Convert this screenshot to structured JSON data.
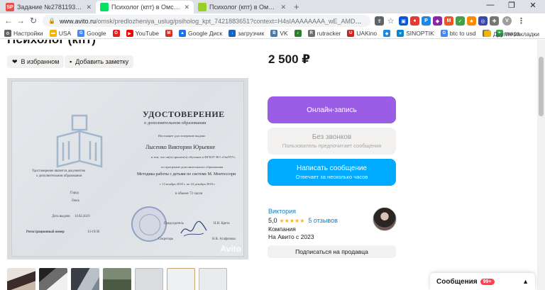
{
  "browser": {
    "tabs": [
      {
        "favicon": "SP",
        "title": "Задание №2781193 - просмотр з..."
      },
      {
        "favicon": "A",
        "title": "Психолог (кпт) в Омске | Услуги ..."
      },
      {
        "favicon": "",
        "title": "Психолог (кпт) в Омске | Услуги..."
      }
    ],
    "new_tab": "+",
    "window_controls": {
      "minimize": "—",
      "maximize": "❐",
      "close": "✕"
    },
    "nav": {
      "back": "←",
      "forward": "→",
      "reload": "↻",
      "home": "⌂"
    },
    "url_host": "www.avito.ru",
    "url_path": "/omsk/predlozheniya_uslug/psiholog_kpt_7421883651?context=H4sIAAAAAAAA_wE_AMD_YToyOntzOjEzOiJsb...",
    "bookmarks": [
      {
        "label": "Настройки",
        "icon": "gear-icon",
        "color": "#5f6368"
      },
      {
        "label": "USA",
        "icon": "folder-icon",
        "color": "#f4b400"
      },
      {
        "label": "Google",
        "icon": "google-icon",
        "color": "#4285f4"
      },
      {
        "label": "",
        "icon": "opera-icon",
        "color": "#e02020"
      },
      {
        "label": "YouTube",
        "icon": "youtube-icon",
        "color": "#ff0000"
      },
      {
        "label": "",
        "icon": "gmail-icon",
        "color": "#d93025"
      },
      {
        "label": "Google Диск",
        "icon": "drive-icon",
        "color": "#1a73e8"
      },
      {
        "label": "загрузчик",
        "icon": "download-icon",
        "color": "#1565c0"
      },
      {
        "label": "VK",
        "icon": "vk-icon",
        "color": "#4a76a8"
      },
      {
        "label": "",
        "icon": "music-icon",
        "color": "#2e7d32"
      },
      {
        "label": "rutracker",
        "icon": "rutracker-icon",
        "color": "#6d6d6d"
      },
      {
        "label": "UAKino",
        "icon": "uakino-icon",
        "color": "#c62828"
      },
      {
        "label": "",
        "icon": "ukraine-icon",
        "color": "#1e88e5"
      },
      {
        "label": "SINOPTIK",
        "icon": "weather-icon",
        "color": "#0288d1"
      },
      {
        "label": "btc to usd",
        "icon": "google-icon",
        "color": "#4285f4"
      },
      {
        "label": "",
        "icon": "doc-icon",
        "color": "#6d6d6d"
      },
      {
        "label": "maps",
        "icon": "maps-icon",
        "color": "#34a853"
      }
    ],
    "other_bookmarks": "Другие закладки"
  },
  "page": {
    "heading": "Психолог (кпт)",
    "favorite_label": "В избранном",
    "note_label": "Добавить заметку",
    "price": "2 500 ₽",
    "watermark": "Avito",
    "certificate": {
      "title": "УДОСТОВЕРЕНИЕ",
      "subtitle": "о дополнительном образовании",
      "line1": "Настоящее удостоверение выдано",
      "name": "Лысенко Виктории Юрьевне",
      "line2": "в том, что он(а) прошел(а) обучение в ФГБОУ ВО «ОмГПУ»",
      "line3": "по программе дополнительного образования",
      "program": "Методика работы с детьми по системе М. Монтессори",
      "dates": "с 13 ноября 2018 г. по 24 декабря 2018 г.",
      "hours": "в объеме 72 часов",
      "left1": "Удостоверение является документом",
      "left2": "о дополнительном образовании",
      "city_label": "Город",
      "city": "Омск",
      "date_label": "Дата выдачи",
      "date": "14.02.2019",
      "reg_label": "Регистрационный номер",
      "reg": "13-19/36",
      "sign1": "Председатель",
      "sign1_name": "Н.И. Крета",
      "sign2": "Секретарь",
      "sign2_name": "Н.В. Агафонова"
    },
    "buttons": {
      "book": "Онлайн-запись",
      "no_calls": "Без звонков",
      "no_calls_sub": "Пользователь предпочитает сообщения",
      "write": "Написать сообщение",
      "write_sub": "Отвечает за несколько часов"
    },
    "seller": {
      "name": "Виктория",
      "rating": "5,0",
      "stars": "★★★★★",
      "reviews": "5 отзывов",
      "type": "Компания",
      "since": "На Авито с 2023"
    },
    "subscribe": "Подписаться на продавца",
    "messages": {
      "label": "Сообщения",
      "badge": "99+"
    }
  },
  "colors": {
    "accent_purple": "#9b5de5",
    "accent_blue": "#00aaff",
    "link": "#0a7ec4",
    "star": "#ffb021"
  }
}
